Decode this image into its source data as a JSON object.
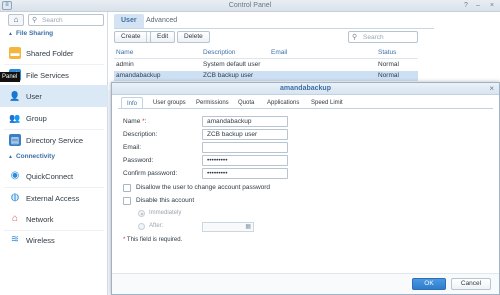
{
  "window": {
    "title": "Control Panel"
  },
  "sidebar": {
    "search_placeholder": "Search",
    "tooltip": "Panel",
    "sections": [
      {
        "label": "File Sharing"
      },
      {
        "label": "Connectivity"
      }
    ],
    "items": [
      {
        "label": "Shared Folder",
        "icon": "folder-icon"
      },
      {
        "label": "File Services",
        "icon": "file-services-icon"
      },
      {
        "label": "User",
        "icon": "user-icon"
      },
      {
        "label": "Group",
        "icon": "group-icon"
      },
      {
        "label": "Directory Service",
        "icon": "directory-icon"
      },
      {
        "label": "QuickConnect",
        "icon": "quickconnect-icon"
      },
      {
        "label": "External Access",
        "icon": "globe-icon"
      },
      {
        "label": "Network",
        "icon": "network-icon"
      },
      {
        "label": "Wireless",
        "icon": "wireless-icon"
      }
    ]
  },
  "main": {
    "tabs": [
      {
        "label": "User"
      },
      {
        "label": "Advanced"
      }
    ],
    "toolbar": {
      "create": "Create",
      "edit": "Edit",
      "delete": "Delete",
      "search_placeholder": "Search"
    },
    "table": {
      "columns": [
        "Name",
        "Description",
        "Email",
        "Status"
      ],
      "rows": [
        {
          "name": "admin",
          "description": "System default user",
          "email": "",
          "status": "Normal"
        },
        {
          "name": "amandabackup",
          "description": "ZCB backup user",
          "email": "",
          "status": "Normal"
        }
      ]
    }
  },
  "dialog": {
    "title": "amandabackup",
    "tabs": [
      "Info",
      "User groups",
      "Permissions",
      "Quota",
      "Applications",
      "Speed Limit"
    ],
    "fields": {
      "name_label": "Name",
      "required_mark": "*",
      "colon": ":",
      "name_value": "amandabackup",
      "description_label": "Description:",
      "description_value": "ZCB backup user",
      "email_label": "Email:",
      "email_value": "",
      "password_label": "Password:",
      "password_value": "•••••••••",
      "confirm_label": "Confirm password:",
      "confirm_value": "•••••••••"
    },
    "options": {
      "disallow_change": "Disallow the user to change account password",
      "disable_account": "Disable this account",
      "immediately": "Immediately",
      "after": "After:"
    },
    "note_star": "*",
    "note": " This field is required.",
    "buttons": {
      "ok": "OK",
      "cancel": "Cancel"
    }
  }
}
